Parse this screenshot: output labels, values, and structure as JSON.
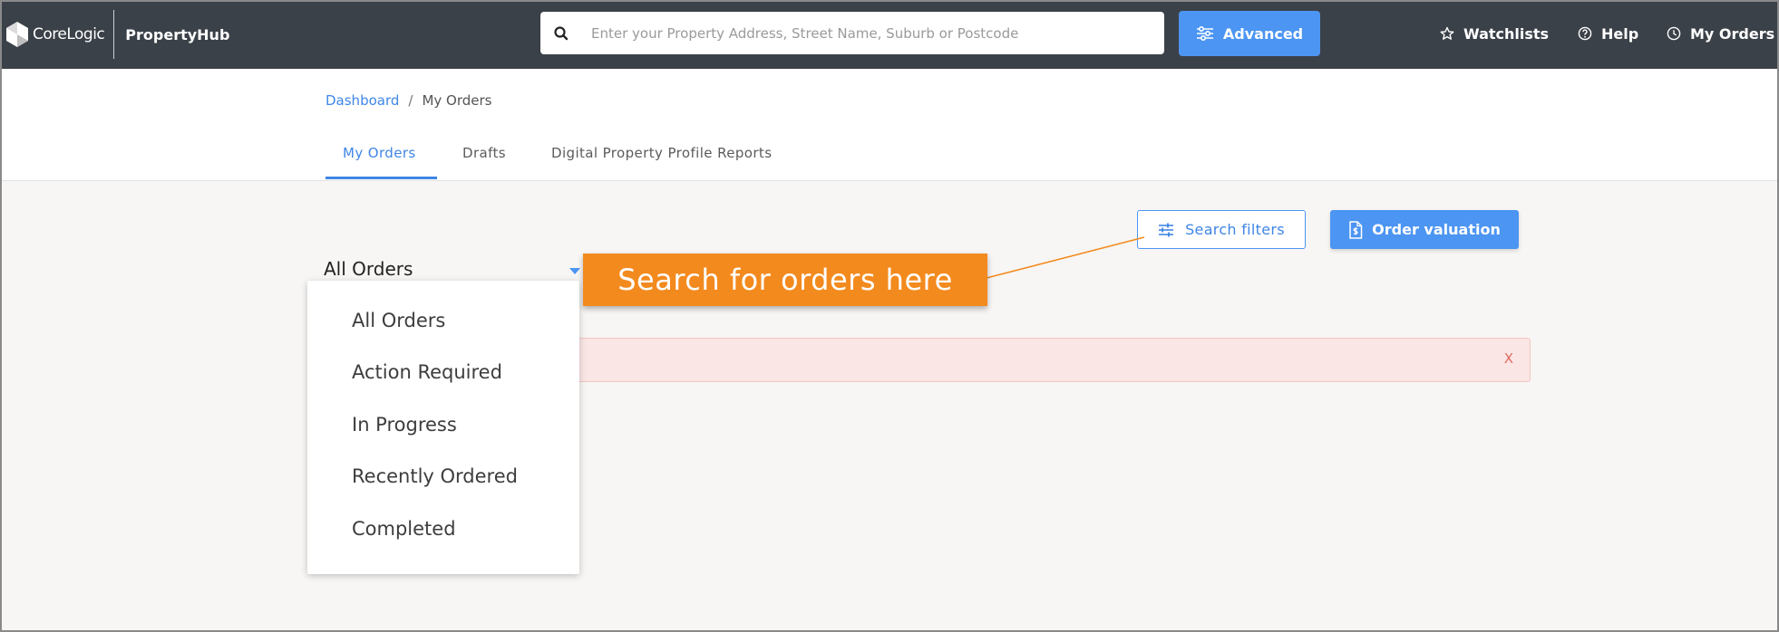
{
  "brand": {
    "company": "CoreLogic",
    "product": "PropertyHub"
  },
  "search": {
    "placeholder": "Enter your Property Address, Street Name, Suburb or Postcode"
  },
  "header": {
    "advanced_label": "Advanced",
    "nav": [
      {
        "label": "Watchlists",
        "icon": "star-icon"
      },
      {
        "label": "Help",
        "icon": "help-circle-icon"
      },
      {
        "label": "My Orders",
        "icon": "clock-icon"
      }
    ]
  },
  "breadcrumb": {
    "home": "Dashboard",
    "separator": "/",
    "current": "My Orders"
  },
  "tabs": [
    {
      "label": "My Orders",
      "active": true
    },
    {
      "label": "Drafts",
      "active": false
    },
    {
      "label": "Digital Property Profile Reports",
      "active": false
    }
  ],
  "toolbar": {
    "filters_label": "Search filters",
    "valuation_label": "Order valuation"
  },
  "order_filter": {
    "selected": "All Orders",
    "options": [
      "All Orders",
      "Action Required",
      "In Progress",
      "Recently Ordered",
      "Completed"
    ]
  },
  "alert": {
    "close_label": "X"
  },
  "annotation": {
    "text": "Search for orders here"
  },
  "colors": {
    "topbar": "#3b4148",
    "accent": "#4c95f2",
    "link": "#3f86e6",
    "callout": "#f38a1e",
    "alert_bg": "#fae6e4"
  }
}
